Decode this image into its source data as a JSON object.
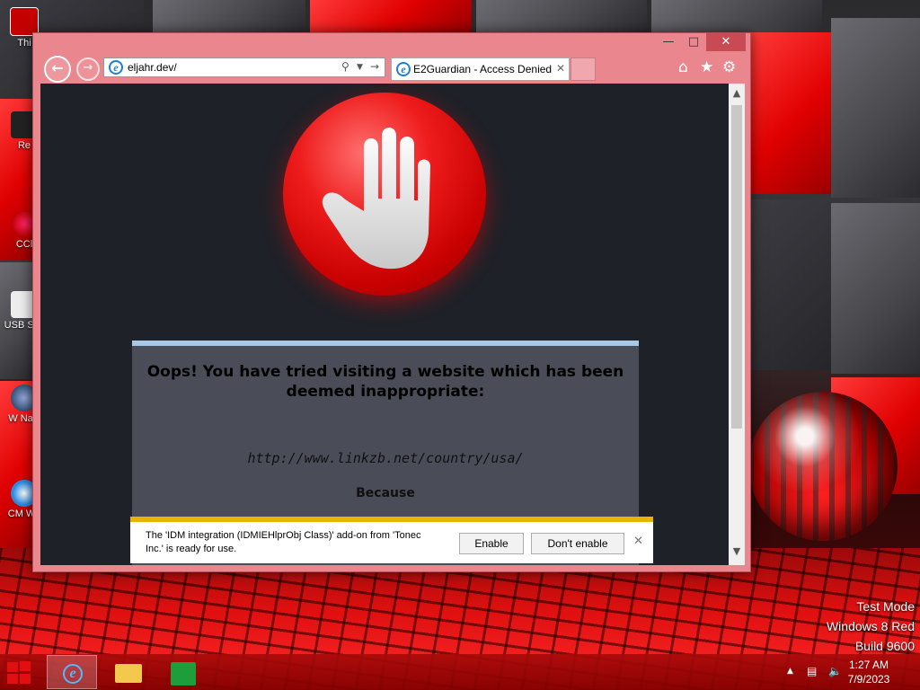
{
  "desktop": {
    "icons": [
      {
        "label": "Thi"
      },
      {
        "label": "Re"
      },
      {
        "label": "CCl"
      },
      {
        "label": "USB Sec"
      },
      {
        "label": "W Navi"
      },
      {
        "label": "CM We"
      }
    ],
    "watermark": {
      "line1": "Test Mode",
      "line2": "Windows 8 Red",
      "line3": "Build 9600"
    }
  },
  "browser": {
    "address": "eljahr.dev/",
    "tab_title": "E2Guardian - Access Denied",
    "controls": {
      "back_icon": "back-arrow-icon",
      "forward_icon": "forward-arrow-icon",
      "home_icon": "home-icon",
      "favorites_icon": "star-icon",
      "settings_icon": "gear-icon"
    }
  },
  "page": {
    "heading": "Oops! You have tried visiting a website which has been deemed inappropriate:",
    "blocked_url": "http://www.linkzb.net/country/usa/",
    "because": "Because"
  },
  "notification": {
    "message": "The 'IDM integration (IDMIEHlprObj Class)' add-on from 'Tonec Inc.' is ready for use.",
    "enable_label": "Enable",
    "dont_enable_label": "Don't enable"
  },
  "taskbar": {
    "time": "1:27 AM",
    "date": "7/9/2023"
  },
  "colors": {
    "window_frame": "#e9868e",
    "page_background": "#1f2128",
    "panel_background": "#4a4d57",
    "stop_red": "#ee1c1c",
    "notification_accent": "#e8b400"
  }
}
